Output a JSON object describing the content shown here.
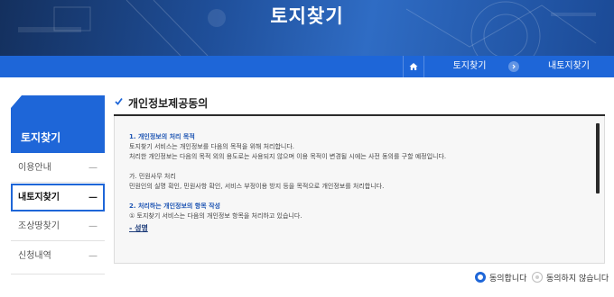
{
  "header": {
    "title": "토지찾기"
  },
  "breadcrumb": {
    "home_icon": "home-icon",
    "items": [
      "토지찾기",
      "내토지찾기"
    ]
  },
  "sidebar": {
    "title": "토지찾기",
    "items": [
      {
        "label": "이용안내",
        "active": false
      },
      {
        "label": "내토지찾기",
        "active": true
      },
      {
        "label": "조상땅찾기",
        "active": false
      },
      {
        "label": "신청내역",
        "active": false
      }
    ]
  },
  "section": {
    "title": "개인정보제공동의"
  },
  "consent": {
    "h1": "1. 개인정보의 처리 목적",
    "p1": "토지찾기 서비스는 개인정보를 다음의 목적을 위해 처리합니다.",
    "p2": "처리한 개인정보는 다음의 목적 외의 용도로는 사용되지 않으며 이용 목적이 변경될 시에는 사전 동의를 구할 예정입니다.",
    "p3": "가. 민원사무 처리",
    "p4": "민원인의 실명 확인, 민원사항 확인, 서비스 부정이용 방지 등을 목적으로 개인정보를 처리합니다.",
    "h2": "2. 처리하는 개인정보의 항목 작성",
    "p5": "① 토지찾기 서비스는 다음의 개인정보 항목을 처리하고 있습니다.",
    "link": "- 성명"
  },
  "agreement": {
    "agree_label": "동의합니다",
    "disagree_label": "동의하지 않습니다",
    "selected": "agree"
  },
  "colors": {
    "accent": "#1e66d8",
    "hero_dark": "#14305e",
    "heading_blue": "#1e55b3"
  }
}
